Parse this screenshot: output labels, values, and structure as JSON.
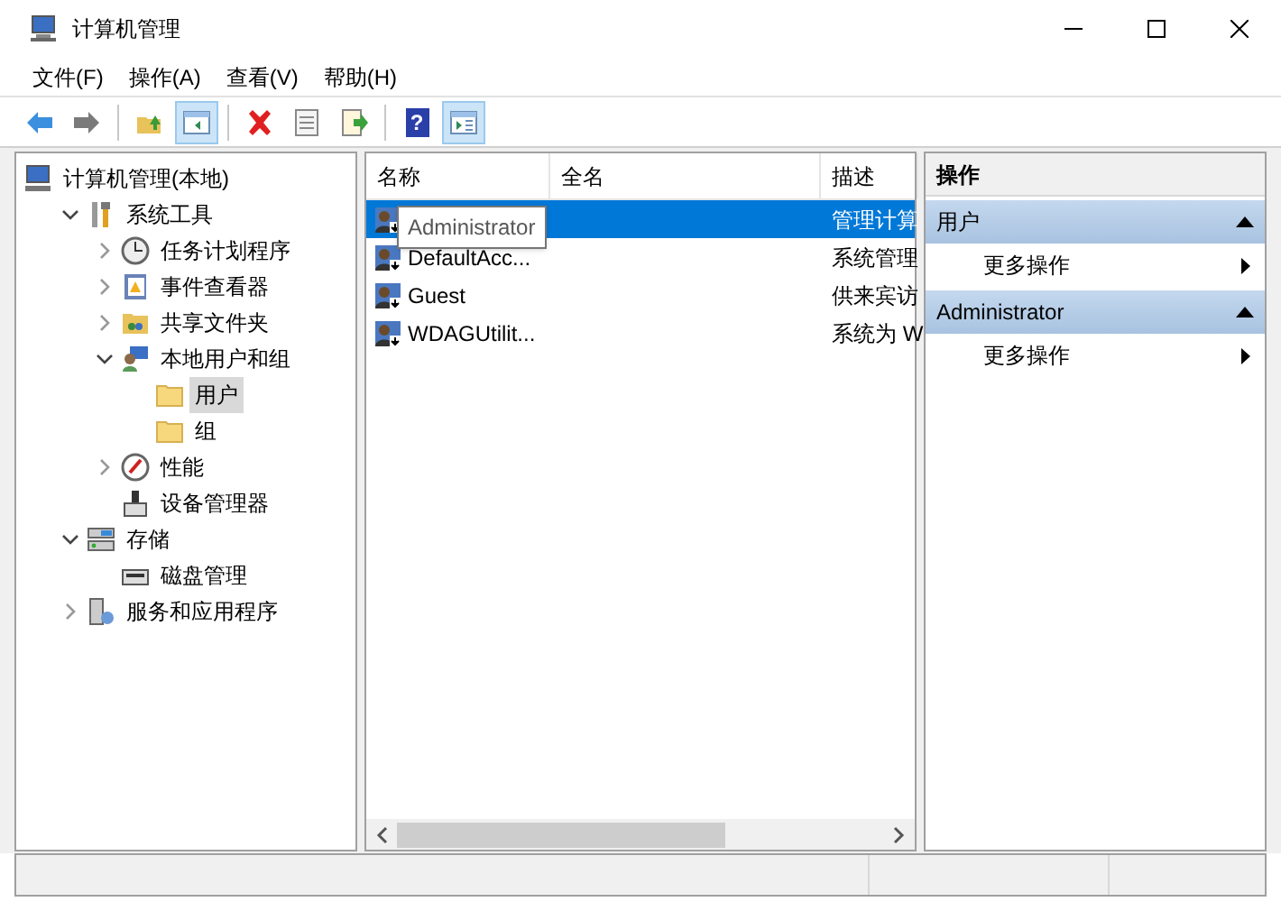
{
  "window": {
    "title": "计算机管理"
  },
  "menu": [
    "文件(F)",
    "操作(A)",
    "查看(V)",
    "帮助(H)"
  ],
  "toolbar": [
    {
      "kind": "back",
      "selected": false
    },
    {
      "kind": "forward",
      "selected": false
    },
    {
      "kind": "sep"
    },
    {
      "kind": "up",
      "selected": false
    },
    {
      "kind": "tree",
      "selected": true
    },
    {
      "kind": "sep"
    },
    {
      "kind": "delete",
      "selected": false
    },
    {
      "kind": "props",
      "selected": false
    },
    {
      "kind": "export",
      "selected": false
    },
    {
      "kind": "sep"
    },
    {
      "kind": "help",
      "selected": false,
      "label": "?"
    },
    {
      "kind": "pane",
      "selected": true
    }
  ],
  "tree": {
    "label": "计算机管理(本地)",
    "selected": false,
    "children": [
      {
        "label": "系统工具",
        "expanded": true,
        "selected": false,
        "children": [
          {
            "label": "任务计划程序",
            "expanded": false,
            "selected": false
          },
          {
            "label": "事件查看器",
            "expanded": false,
            "selected": false
          },
          {
            "label": "共享文件夹",
            "expanded": false,
            "selected": false
          },
          {
            "label": "本地用户和组",
            "expanded": true,
            "selected": false,
            "children": [
              {
                "label": "用户",
                "selected": true
              },
              {
                "label": "组",
                "selected": false
              }
            ]
          },
          {
            "label": "性能",
            "expanded": false,
            "selected": false
          },
          {
            "label": "设备管理器",
            "selected": false
          }
        ]
      },
      {
        "label": "存储",
        "expanded": true,
        "selected": false,
        "children": [
          {
            "label": "磁盘管理",
            "selected": false
          }
        ]
      },
      {
        "label": "服务和应用程序",
        "expanded": false,
        "selected": false
      }
    ]
  },
  "table": {
    "columns": [
      "名称",
      "全名",
      "描述"
    ],
    "rows": [
      {
        "description": "管理计算",
        "selected": true
      },
      {
        "name": "DefaultAcc...",
        "description": "系统管理",
        "selected": false
      },
      {
        "name": "Guest",
        "description": "供来宾访",
        "selected": false
      },
      {
        "name": "WDAGUtilit...",
        "description": "系统为 W",
        "selected": false
      }
    ],
    "tooltip": "Administrator"
  },
  "actions": {
    "title": "操作",
    "sections": [
      {
        "title": "用户",
        "expanded": true,
        "items": [
          "更多操作"
        ]
      },
      {
        "title": "Administrator",
        "expanded": true,
        "items": [
          "更多操作"
        ]
      }
    ]
  }
}
